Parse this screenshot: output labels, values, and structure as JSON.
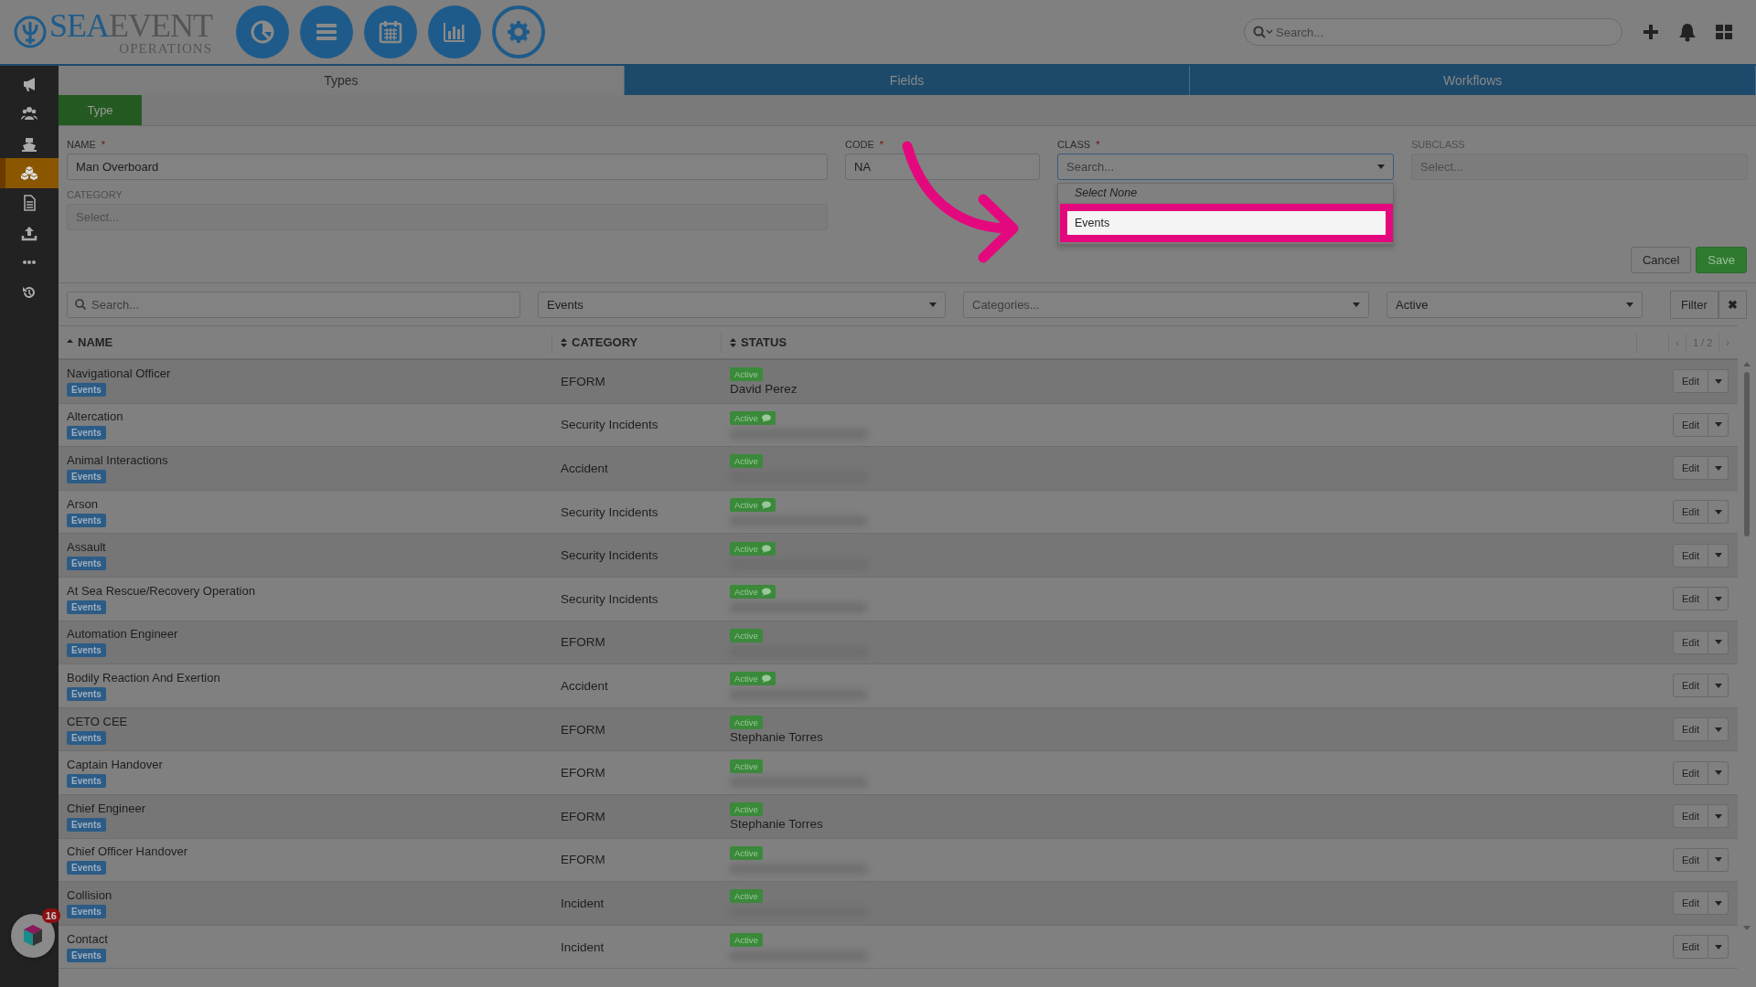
{
  "logo": {
    "brand_a": "SEA",
    "brand_b": "EVENT",
    "subtitle": "OPERATIONS"
  },
  "nav_buttons": [
    {
      "selected": false
    },
    {
      "selected": false
    },
    {
      "selected": false
    },
    {
      "selected": false
    },
    {
      "selected": true
    }
  ],
  "search": {
    "placeholder": "Search..."
  },
  "sidebar": {
    "items": [
      {
        "selected": false
      },
      {
        "selected": false
      },
      {
        "selected": false
      },
      {
        "selected": true
      },
      {
        "selected": false
      },
      {
        "selected": false
      },
      {
        "selected": false
      },
      {
        "selected": false
      }
    ]
  },
  "tabs": [
    {
      "label": "Types",
      "selected": true
    },
    {
      "label": "Fields",
      "selected": false
    },
    {
      "label": "Workflows",
      "selected": false
    }
  ],
  "subtabs": [
    {
      "label": "Type",
      "selected": true
    }
  ],
  "form": {
    "fields": [
      {
        "label": "NAME",
        "required_mark": "*",
        "kind": "text",
        "value": "Man Overboard",
        "disabled": false
      },
      {
        "label": "CODE",
        "required_mark": "*",
        "kind": "text",
        "value": "NA",
        "disabled": false
      },
      {
        "label": "CLASS",
        "required_mark": "*",
        "kind": "select",
        "placeholder": "Search...",
        "disabled": false,
        "open": true
      },
      {
        "label": "SUBCLASS",
        "kind": "select",
        "placeholder": "Select...",
        "disabled": true,
        "open": false
      },
      {
        "label": "CATEGORY",
        "kind": "select",
        "placeholder": "Select...",
        "disabled": true,
        "open": false
      }
    ],
    "dropdown": {
      "options": [
        {
          "label": "Select None",
          "highlighted": false
        },
        {
          "label": "Events",
          "highlighted": true
        }
      ]
    },
    "actions": [
      {
        "label": "Cancel",
        "kind": "default"
      },
      {
        "label": "Save",
        "kind": "primary"
      }
    ]
  },
  "filters": {
    "search_placeholder": "Search...",
    "class_value": "Events",
    "categories_placeholder": "Categories...",
    "status_value": "Active",
    "filter_button": "Filter",
    "clear_button": "✖"
  },
  "table": {
    "columns": [
      {
        "label": "NAME",
        "sorted": true
      },
      {
        "label": "CATEGORY",
        "sorted": false
      },
      {
        "label": "STATUS",
        "sorted": false
      }
    ],
    "pager": {
      "prev": "‹",
      "page": "1 / 2",
      "next": "›"
    },
    "rows": [
      {
        "name": "Navigational Officer",
        "tag": "Events",
        "category": "EFORM",
        "status": "Active",
        "comment": false,
        "owner": "David Perez",
        "edit": "Edit"
      },
      {
        "name": "Altercation",
        "tag": "Events",
        "category": "Security Incidents",
        "status": "Active",
        "comment": true,
        "edit": "Edit"
      },
      {
        "name": "Animal Interactions",
        "tag": "Events",
        "category": "Accident",
        "status": "Active",
        "comment": false,
        "edit": "Edit"
      },
      {
        "name": "Arson",
        "tag": "Events",
        "category": "Security Incidents",
        "status": "Active",
        "comment": true,
        "edit": "Edit"
      },
      {
        "name": "Assault",
        "tag": "Events",
        "category": "Security Incidents",
        "status": "Active",
        "comment": true,
        "edit": "Edit"
      },
      {
        "name": "At Sea Rescue/Recovery Operation",
        "tag": "Events",
        "category": "Security Incidents",
        "status": "Active",
        "comment": true,
        "edit": "Edit"
      },
      {
        "name": "Automation Engineer",
        "tag": "Events",
        "category": "EFORM",
        "status": "Active",
        "comment": false,
        "edit": "Edit"
      },
      {
        "name": "Bodily Reaction And Exertion",
        "tag": "Events",
        "category": "Accident",
        "status": "Active",
        "comment": true,
        "edit": "Edit"
      },
      {
        "name": "CETO CEE",
        "tag": "Events",
        "category": "EFORM",
        "status": "Active",
        "comment": false,
        "owner": "Stephanie Torres",
        "edit": "Edit"
      },
      {
        "name": "Captain Handover",
        "tag": "Events",
        "category": "EFORM",
        "status": "Active",
        "comment": false,
        "edit": "Edit"
      },
      {
        "name": "Chief Engineer",
        "tag": "Events",
        "category": "EFORM",
        "status": "Active",
        "comment": false,
        "owner": "Stephanie Torres",
        "edit": "Edit"
      },
      {
        "name": "Chief Officer Handover",
        "tag": "Events",
        "category": "EFORM",
        "status": "Active",
        "comment": false,
        "edit": "Edit"
      },
      {
        "name": "Collision",
        "tag": "Events",
        "category": "Incident",
        "status": "Active",
        "comment": false,
        "edit": "Edit"
      },
      {
        "name": "Contact",
        "tag": "Events",
        "category": "Incident",
        "status": "Active",
        "comment": false,
        "edit": "Edit"
      }
    ]
  },
  "widget": {
    "badge": "16"
  }
}
